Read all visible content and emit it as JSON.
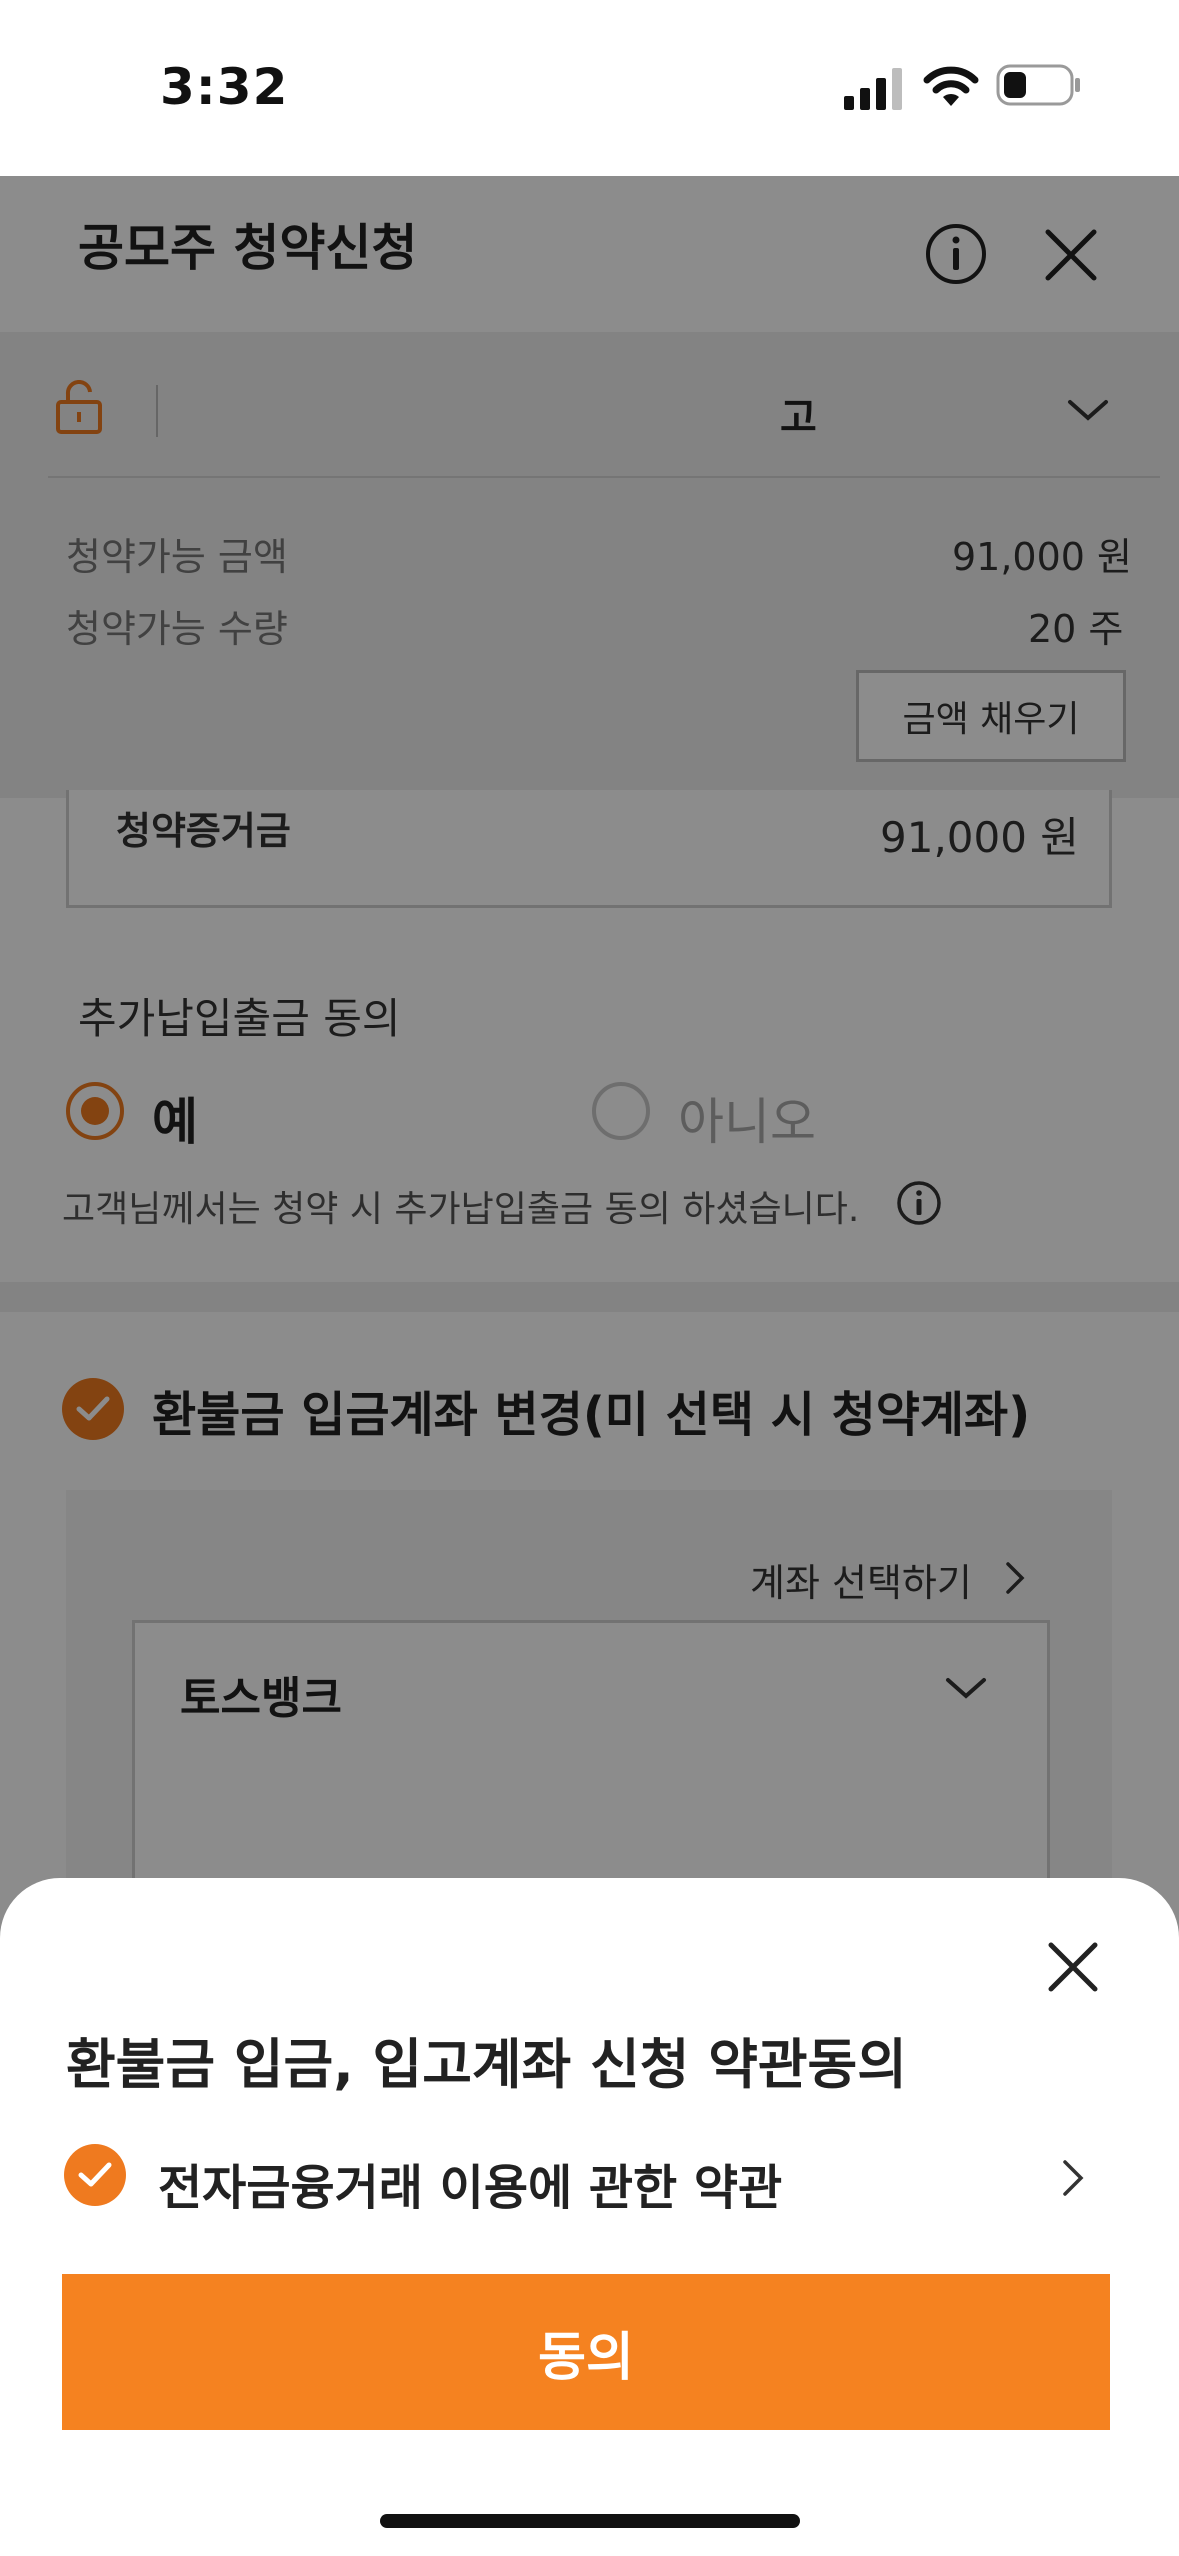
{
  "status_bar": {
    "time": "3:32"
  },
  "header": {
    "title": "공모주 청약신청"
  },
  "account": {
    "name": "고"
  },
  "available": {
    "amount_label": "청약가능 금액",
    "amount_value": "91,000 원",
    "qty_label": "청약가능 수량",
    "qty_value": "20 주",
    "fill_button": "금액 채우기"
  },
  "deposit": {
    "label": "청약증거금",
    "value": "91,000 원"
  },
  "additional": {
    "title": "추가납입출금 동의",
    "yes": "예",
    "no": "아니오",
    "note": "고객님께서는 청약 시 추가납입출금 동의 하셨습니다."
  },
  "refund": {
    "title": "환불금 입금계좌 변경(미 선택 시 청약계좌)",
    "select_account": "계좌 선택하기",
    "bank": "토스뱅크"
  },
  "sheet": {
    "title": "환불금 입금, 입고계좌 신청 약관동의",
    "terms_label": "전자금융거래 이용에 관한 약관",
    "agree_button": "동의"
  },
  "colors": {
    "accent": "#f58220",
    "check": "#ef7a1f"
  }
}
